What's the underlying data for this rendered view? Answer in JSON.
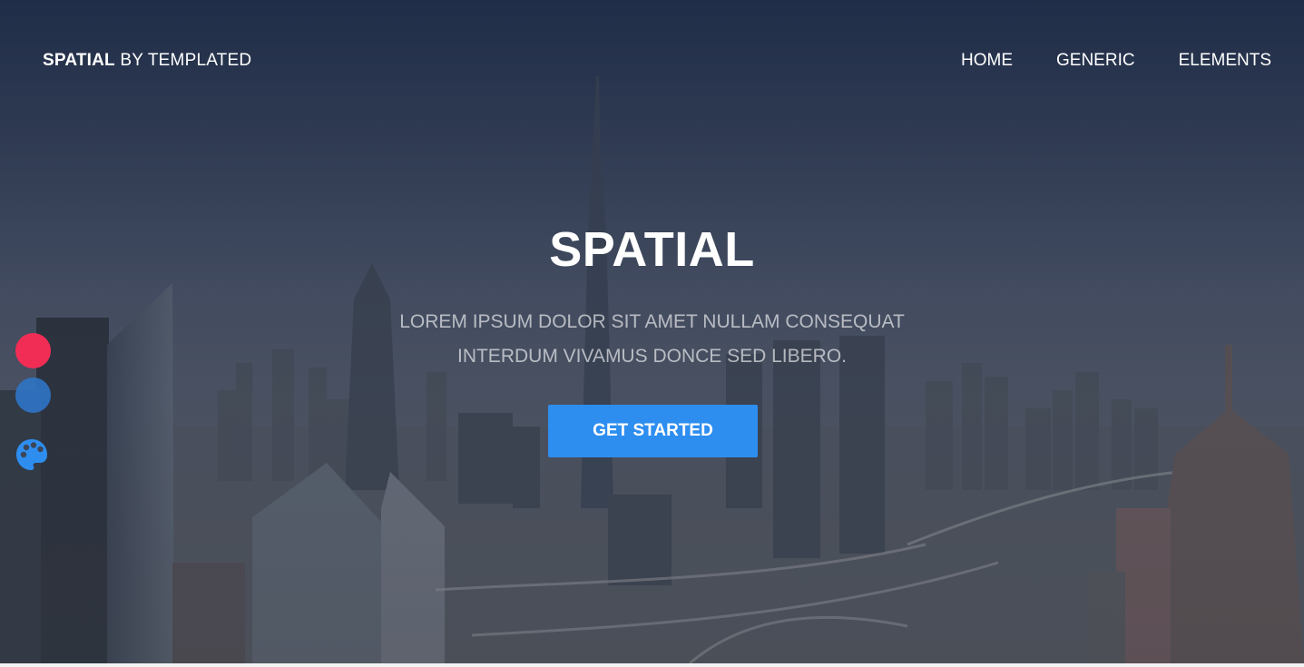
{
  "header": {
    "brand_bold": "SPATIAL",
    "brand_rest": " BY TEMPLATED",
    "nav": [
      "HOME",
      "GENERIC",
      "ELEMENTS"
    ]
  },
  "banner": {
    "title": "SPATIAL",
    "subtitle_line1": "LOREM IPSUM DOLOR SIT AMET NULLAM CONSEQUAT",
    "subtitle_line2": "INTERDUM VIVAMUS DONCE SED LIBERO.",
    "button_label": "GET STARTED"
  },
  "style_switcher": {
    "swatches": [
      {
        "name": "red",
        "color": "#f12d55"
      },
      {
        "name": "blue",
        "color": "#2f74c6"
      }
    ],
    "palette_icon": "palette-icon",
    "palette_color": "#2e8ef0"
  },
  "colors": {
    "accent": "#2e8ef0",
    "text": "#ffffff"
  }
}
